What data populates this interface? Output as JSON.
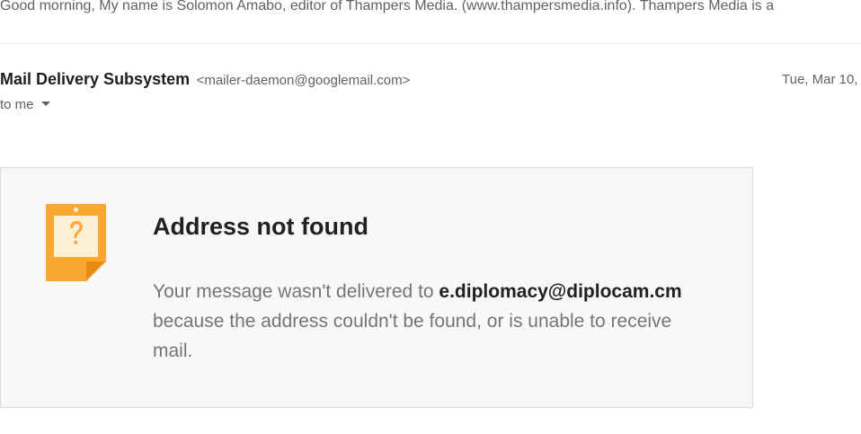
{
  "preview": {
    "text": "Good morning, My name is Solomon Amabo, editor of Thampers Media. (www.thampersmedia.info). Thampers Media is a"
  },
  "message": {
    "sender_name": "Mail Delivery Subsystem",
    "sender_email": "<mailer-daemon@googlemail.com>",
    "date": "Tue, Mar 10,",
    "recipient_label": "to me"
  },
  "bounce": {
    "icon": "question-document-icon",
    "title": "Address not found",
    "body_prefix": "Your message wasn't delivered to ",
    "address": "e.diplomacy@diplocam.cm",
    "body_suffix": " because the address couldn't be found, or is unable to receive mail."
  },
  "colors": {
    "icon_orange": "#FBA832",
    "icon_light": "#FDEFD3",
    "card_background": "#F8F8F8",
    "card_border": "#DADCE0"
  }
}
